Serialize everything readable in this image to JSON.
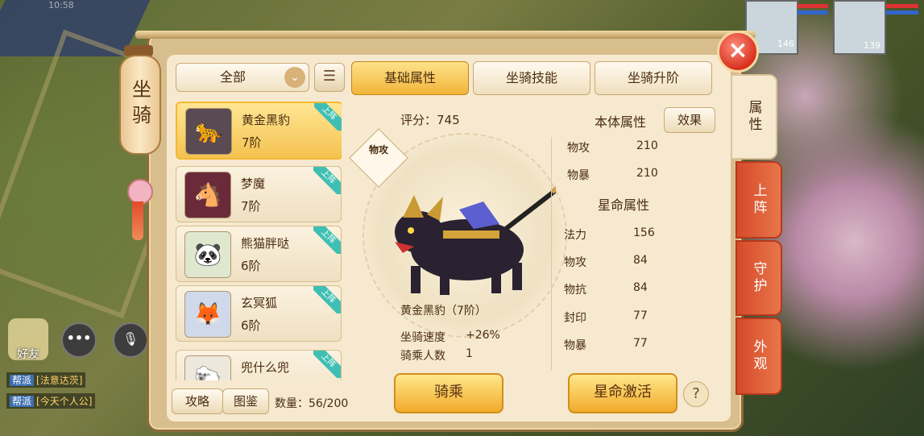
{
  "status": {
    "time": "10:58"
  },
  "lantern": {
    "title": "坐骑"
  },
  "filter": {
    "selected": "全部"
  },
  "tabs": [
    {
      "label": "基础属性",
      "active": true
    },
    {
      "label": "坐骑技能",
      "active": false
    },
    {
      "label": "坐骑升阶",
      "active": false
    }
  ],
  "mounts": [
    {
      "name": "黄金黑豹",
      "level": "7阶",
      "badge": "上阵",
      "selected": true,
      "icon": "panther-icon"
    },
    {
      "name": "梦魔",
      "level": "7阶",
      "badge": "上阵",
      "selected": false,
      "icon": "nightmare-icon"
    },
    {
      "name": "熊猫胖哒",
      "level": "6阶",
      "badge": "上阵",
      "selected": false,
      "icon": "panda-icon"
    },
    {
      "name": "玄冥狐",
      "level": "6阶",
      "badge": "上阵",
      "selected": false,
      "icon": "fox-icon"
    },
    {
      "name": "兜什么兜",
      "level": "",
      "badge": "上阵",
      "selected": false,
      "icon": "creature-icon"
    }
  ],
  "list_footer": {
    "guide": "攻略",
    "codex": "图鉴",
    "count": "数量：56/200"
  },
  "detail": {
    "score": "评分：745",
    "type": "物攻",
    "mount_name": "黄金黑豹（7阶）",
    "speed_label": "坐骑速度",
    "speed_value": "+26%",
    "riders_label": "骑乘人数",
    "riders_value": "1",
    "ride_button": "骑乘",
    "star_button": "星命激活",
    "help": "?"
  },
  "attributes": {
    "base_title": "本体属性",
    "effect_button": "效果",
    "base": [
      {
        "key": "物攻",
        "value": "210"
      },
      {
        "key": "物暴",
        "value": "210"
      }
    ],
    "star_title": "星命属性",
    "star": [
      {
        "key": "法力",
        "value": "156"
      },
      {
        "key": "物攻",
        "value": "84"
      },
      {
        "key": "物抗",
        "value": "84"
      },
      {
        "key": "封印",
        "value": "77"
      },
      {
        "key": "物暴",
        "value": "77"
      }
    ]
  },
  "side_tabs": [
    {
      "label": "属性",
      "active": true
    },
    {
      "label": "上阵",
      "active": false
    },
    {
      "label": "守护",
      "active": false
    },
    {
      "label": "外观",
      "active": false
    }
  ],
  "chat": {
    "friends_label": "好友",
    "chat_icon_text": "•••",
    "lines": [
      {
        "tag": "帮派",
        "text": "[法意达茨]"
      },
      {
        "tag": "帮派",
        "text": "[今天个人公]"
      }
    ]
  },
  "portraits": [
    {
      "level": "146"
    },
    {
      "level": "139"
    }
  ],
  "colors": {
    "accent": "#f1b43a",
    "badge": "#3fbfb3",
    "panel": "#f6e9cf",
    "tab_red": "#d64a2a"
  }
}
